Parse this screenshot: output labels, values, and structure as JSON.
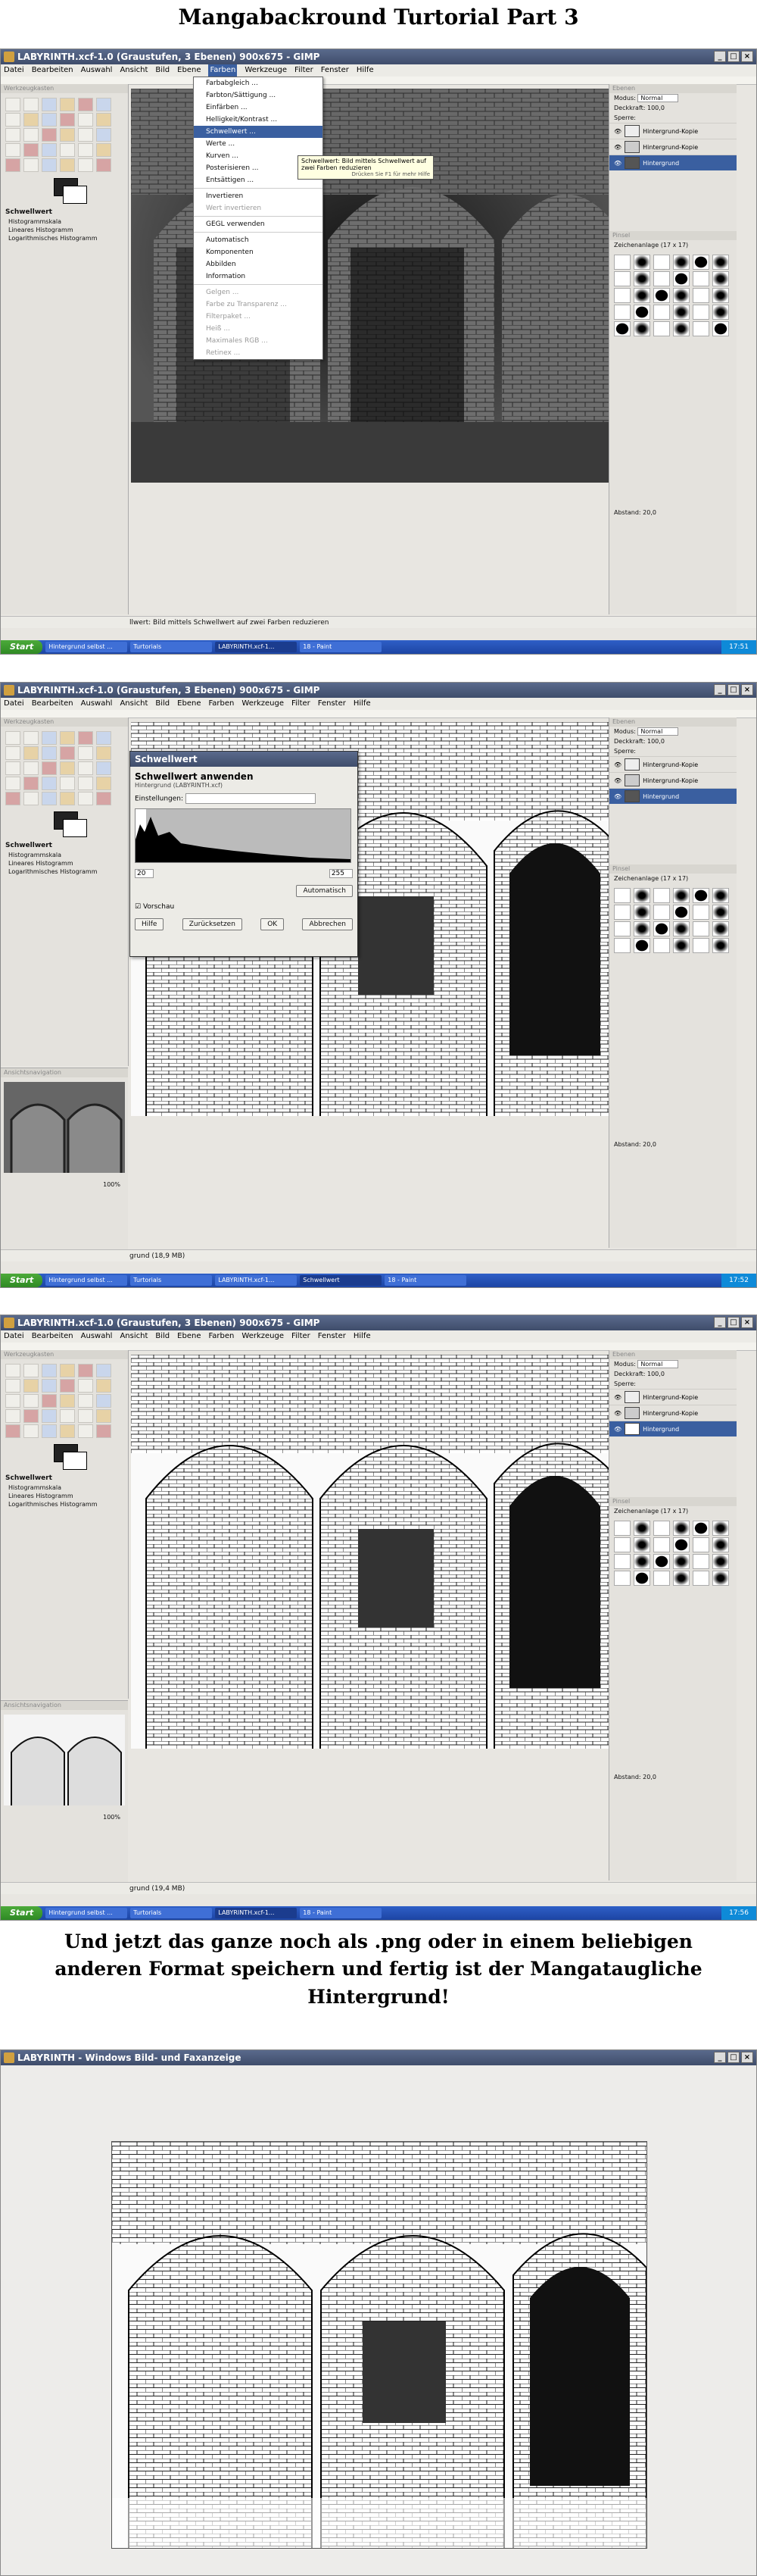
{
  "headings": {
    "title": "Mangabackround Turtorial Part 3",
    "caption": "Und jetzt das ganze noch als .png oder in einem beliebigen anderen Format speichern und fertig ist der Mangataugliche Hintergrund!"
  },
  "gimp": {
    "window_title": "LABYRINTH.xcf-1.0 (Graustufen, 3 Ebenen) 900x675 - GIMP",
    "menus": [
      "Datei",
      "Bearbeiten",
      "Auswahl",
      "Ansicht",
      "Bild",
      "Ebene",
      "Farben",
      "Werkzeuge",
      "Filter",
      "Fenster",
      "Hilfe"
    ],
    "active_menu": "Farben",
    "toolbox_title": "Werkzeugkasten",
    "tool_options_title": "Schwellwert",
    "histogram_label": "Histogrammskala",
    "histogram_options": [
      "Lineares Histogramm",
      "Logarithmisches Histogramm"
    ],
    "navigation_title": "Ansichtsnavigation",
    "zoom": "100%",
    "layers_title": "Ebenen",
    "mode_label": "Modus:",
    "mode_value": "Normal",
    "opacity_label": "Deckkraft:",
    "opacity_value": "100,0",
    "lock_label": "Sperre:",
    "layers": [
      "Hintergrund-Kopie",
      "Hintergrund-Kopie",
      "Hintergrund"
    ],
    "brushes_title": "Pinsel",
    "brushes_sub": "Zeichenanlage (17 x 17)",
    "spacing_label": "Abstand:",
    "spacing_value": "20,0"
  },
  "colors_menu": {
    "items": [
      "Farbabgleich ...",
      "Farbton/Sättigung ...",
      "Einfärben ...",
      "Helligkeit/Kontrast ...",
      "Schwellwert ...",
      "Werte ...",
      "Kurven ...",
      "Posterisieren ...",
      "Entsättigen ...",
      "Invertieren",
      "Wert invertieren",
      "GEGL verwenden",
      "Automatisch",
      "Komponenten",
      "Abbilden",
      "Information",
      "Gelgen ...",
      "Farbe zu Transparenz ...",
      "Filterpaket ...",
      "Heiß ...",
      "Maximales RGB ...",
      "Retinex ..."
    ],
    "highlighted": "Schwellwert ...",
    "tooltip": "Schwellwert: Bild mittels Schwellwert auf zwei Farben reduzieren",
    "tooltip_hint": "Drücken Sie F1 für mehr Hilfe"
  },
  "threshold_dialog": {
    "title": "Schwellwert",
    "heading": "Schwellwert anwenden",
    "subheading": "Hintergrund (LABYRINTH.xcf)",
    "presets_label": "Einstellungen:",
    "low": "20",
    "high": "255",
    "auto_button": "Automatisch",
    "preview_label": "Vorschau",
    "buttons": [
      "Hilfe",
      "Zurücksetzen",
      "OK",
      "Abbrechen"
    ]
  },
  "status": {
    "shot1": "llwert: Bild mittels Schwellwert auf zwei Farben reduzieren",
    "shot2": "grund (18,9 MB)",
    "shot3": "grund (19,4 MB)"
  },
  "taskbars": {
    "start": "Start",
    "shot1": {
      "tasks": [
        "Hintergrund selbst ...",
        "Turtorials",
        "LABYRINTH.xcf-1...",
        "18 - Paint"
      ],
      "active": 2,
      "time": "17:51"
    },
    "shot2": {
      "tasks": [
        "Hintergrund selbst ...",
        "Turtorials",
        "LABYRINTH.xcf-1...",
        "Schwellwert",
        "18 - Paint"
      ],
      "active": 3,
      "time": "17:52"
    },
    "shot3": {
      "tasks": [
        "Hintergrund selbst ...",
        "Turtorials",
        "LABYRINTH.xcf-1...",
        "18 - Paint"
      ],
      "active": 2,
      "time": "17:56"
    }
  },
  "viewer": {
    "window_title": "LABYRINTH - Windows Bild- und Faxanzeige"
  }
}
